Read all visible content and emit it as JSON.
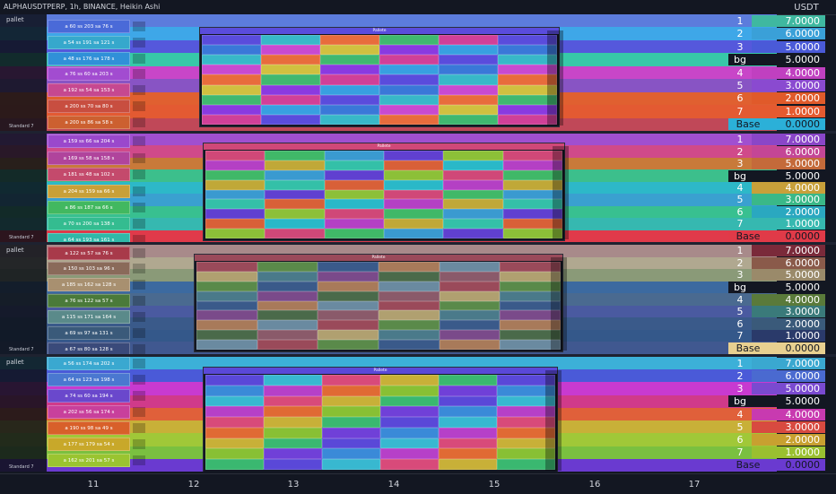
{
  "header": {
    "symbol_line": "ALPHAUSDTPERP, 1h, BINANCE, Heikin Ashi",
    "axis_unit": "USDT"
  },
  "x_axis_ticks": [
    "11",
    "12",
    "13",
    "14",
    "15",
    "16",
    "17"
  ],
  "panes": [
    {
      "label": "pallet",
      "footer": "Standard 7",
      "stripes": [
        "#5c7cdc",
        "#3ea7e8",
        "#5558dc",
        "#37c8a8",
        "#c846c8",
        "#8854c4",
        "#e06030",
        "#e35a32",
        "#c04858"
      ],
      "cells": [
        {
          "text": "a 60 ss 203 sa 76 s",
          "color": "#4a6ad8"
        },
        {
          "text": "a 54 ss 191 sa 121 s",
          "color": "#36a8cc"
        },
        {
          "text": "a 48 ss 176 sa 178 s",
          "color": "#3090d8"
        },
        {
          "text": "a 76 ss 60 sa 203 s",
          "color": "#a24cd0"
        },
        {
          "text": "a 192 ss 54 sa 153 s",
          "color": "#c64890"
        },
        {
          "text": "a 200 ss 70 sa 80 s",
          "color": "#c84e40"
        },
        {
          "text": "a 200 ss 86 sa 58 s",
          "color": "#cc6030"
        }
      ],
      "palette_colors": [
        "#5a4cdc",
        "#3a78d8",
        "#38b8c8",
        "#c84ad0",
        "#e86c3c",
        "#d0c040",
        "#40b870",
        "#8a3ae0",
        "#d04098",
        "#38a0e0"
      ],
      "palette_title": "Pallete",
      "levels": [
        {
          "n": "1",
          "v": "7.0000",
          "c": "#3fb8a0"
        },
        {
          "n": "2",
          "v": "6.0000",
          "c": "#3aa0d8"
        },
        {
          "n": "3",
          "v": "5.0000",
          "c": "#4a5ad8"
        },
        {
          "n": "bg",
          "v": "5.0000",
          "c": "#131722"
        },
        {
          "n": "4",
          "v": "4.0000",
          "c": "#c040c0"
        },
        {
          "n": "5",
          "v": "3.0000",
          "c": "#8a4ad0"
        },
        {
          "n": "6",
          "v": "2.0000",
          "c": "#e05a2a"
        },
        {
          "n": "7",
          "v": "1.0000",
          "c": "#e45a30"
        },
        {
          "n": "Base",
          "v": "0.0000",
          "c": "#2bb0d8"
        }
      ]
    },
    {
      "label": "",
      "footer": "Standard 7",
      "stripes": [
        "#a04fd0",
        "#d04a8a",
        "#c87a3a",
        "#3cbf8c",
        "#2db8c8",
        "#3aa0d0",
        "#38c090",
        "#36b8b0",
        "#e03a4a"
      ],
      "cells": [
        {
          "text": "a 159 ss 66 sa 204 s",
          "color": "#9a48cc"
        },
        {
          "text": "a 169 ss 58 sa 158 s",
          "color": "#b0449c"
        },
        {
          "text": "a 181 ss 48 sa 102 s",
          "color": "#c44a6c"
        },
        {
          "text": "a 204 ss 159 sa 66 s",
          "color": "#c8a038"
        },
        {
          "text": "a 86 ss 187 sa 66 s",
          "color": "#42b860"
        },
        {
          "text": "a 70 ss 200 sa 138 s",
          "color": "#34bc90"
        },
        {
          "text": "a 64 ss 193 sa 161 s",
          "color": "#30b8a8"
        }
      ],
      "palette_colors": [
        "#d04878",
        "#b440c4",
        "#40b868",
        "#c0a838",
        "#3a9ad0",
        "#34c0a8",
        "#6040d0",
        "#d86038",
        "#8cc038",
        "#2ab8c8"
      ],
      "palette_title": "Pallete",
      "levels": [
        {
          "n": "1",
          "v": "7.0000",
          "c": "#8a46c8"
        },
        {
          "n": "2",
          "v": "6.0000",
          "c": "#c44696"
        },
        {
          "n": "3",
          "v": "5.0000",
          "c": "#c46a3a"
        },
        {
          "n": "bg",
          "v": "5.0000",
          "c": "#131722"
        },
        {
          "n": "4",
          "v": "4.0000",
          "c": "#c8a03a"
        },
        {
          "n": "5",
          "v": "3.0000",
          "c": "#3ab888"
        },
        {
          "n": "6",
          "v": "2.0000",
          "c": "#2aa8c0"
        },
        {
          "n": "7",
          "v": "1.0000",
          "c": "#36b8b0"
        },
        {
          "n": "Base",
          "v": "0.0000",
          "c": "#e03a48"
        }
      ]
    },
    {
      "label": "pallet",
      "footer": "Standard 7",
      "stripes": [
        "#a88a8a",
        "#b0a890",
        "#8a9a78",
        "#3c6aa0",
        "#4a6a90",
        "#4a5aa0",
        "#3a5a8a",
        "#34588a",
        "#405890"
      ],
      "cells": [
        {
          "text": "a 122 ss 57 sa 76 s",
          "color": "#a83a4a"
        },
        {
          "text": "a 150 ss 103 sa 96 s",
          "color": "#8a6a5a"
        },
        {
          "text": "a 185 ss 162 sa 128 s",
          "color": "#a89070"
        },
        {
          "text": "a 76 ss 122 sa 57 s",
          "color": "#4a7a3a"
        },
        {
          "text": "a 115 ss 171 sa 164 s",
          "color": "#5a8a8a"
        },
        {
          "text": "a 69 ss 97 sa 131 s",
          "color": "#3a5a7a"
        },
        {
          "text": "a 67 ss 80 sa 128 s",
          "color": "#3a4a7a"
        }
      ],
      "palette_colors": [
        "#9a4a5a",
        "#b0a070",
        "#5a8a4a",
        "#4a7a8a",
        "#3a5a8a",
        "#7a4a8a",
        "#a87a5a",
        "#4a6a4a",
        "#6a8aa0",
        "#8a5a6a"
      ],
      "palette_title": "Pallete",
      "levels": [
        {
          "n": "1",
          "v": "7.0000",
          "c": "#7a2a3a"
        },
        {
          "n": "2",
          "v": "6.0000",
          "c": "#8a5a4a"
        },
        {
          "n": "3",
          "v": "5.0000",
          "c": "#9a8a6a"
        },
        {
          "n": "bg",
          "v": "5.0000",
          "c": "#131722"
        },
        {
          "n": "4",
          "v": "4.0000",
          "c": "#5a7a3a"
        },
        {
          "n": "5",
          "v": "3.0000",
          "c": "#3a7a7a"
        },
        {
          "n": "6",
          "v": "2.0000",
          "c": "#3a5a7a"
        },
        {
          "n": "7",
          "v": "1.0000",
          "c": "#2a3a6a"
        },
        {
          "n": "Base",
          "v": "0.0000",
          "c": "#e8d090"
        }
      ]
    },
    {
      "label": "pallet",
      "footer": "Standard 7",
      "stripes": [
        "#3cb0d8",
        "#4a5ad8",
        "#c83ad0",
        "#d03a8a",
        "#e0603a",
        "#c8b038",
        "#a0c838",
        "#7ac040",
        "#6a3ad0"
      ],
      "cells": [
        {
          "text": "a 56 ss 174 sa 202 s",
          "color": "#3aa8d0"
        },
        {
          "text": "a 64 ss 123 sa 198 s",
          "color": "#4a78d0"
        },
        {
          "text": "a 74 ss 60 sa 194 s",
          "color": "#6a48cc"
        },
        {
          "text": "a 202 ss 56 sa 174 s",
          "color": "#c8409c"
        },
        {
          "text": "a 190 ss 98 sa 49 s",
          "color": "#d8602a"
        },
        {
          "text": "a 177 ss 179 sa 54 s",
          "color": "#c8a82a"
        },
        {
          "text": "a 162 ss 201 sa 57 s",
          "color": "#9ac430"
        }
      ],
      "palette_colors": [
        "#5a48d8",
        "#3a8ad8",
        "#38b8d0",
        "#b640c8",
        "#d84a7a",
        "#e06a34",
        "#c8b038",
        "#88c034",
        "#3ab870",
        "#7040d8"
      ],
      "palette_title": "Pallete",
      "levels": [
        {
          "n": "1",
          "v": "7.0000",
          "c": "#3aa8d0"
        },
        {
          "n": "2",
          "v": "6.0000",
          "c": "#4a6ad0"
        },
        {
          "n": "3",
          "v": "5.0000",
          "c": "#7a4ad0"
        },
        {
          "n": "bg",
          "v": "5.0000",
          "c": "#131722"
        },
        {
          "n": "4",
          "v": "4.0000",
          "c": "#c83ab0"
        },
        {
          "n": "5",
          "v": "3.0000",
          "c": "#d84a40"
        },
        {
          "n": "6",
          "v": "2.0000",
          "c": "#c8a030"
        },
        {
          "n": "7",
          "v": "1.0000",
          "c": "#9ac030"
        },
        {
          "n": "Base",
          "v": "0.0000",
          "c": "#6a3ad0"
        }
      ]
    }
  ]
}
